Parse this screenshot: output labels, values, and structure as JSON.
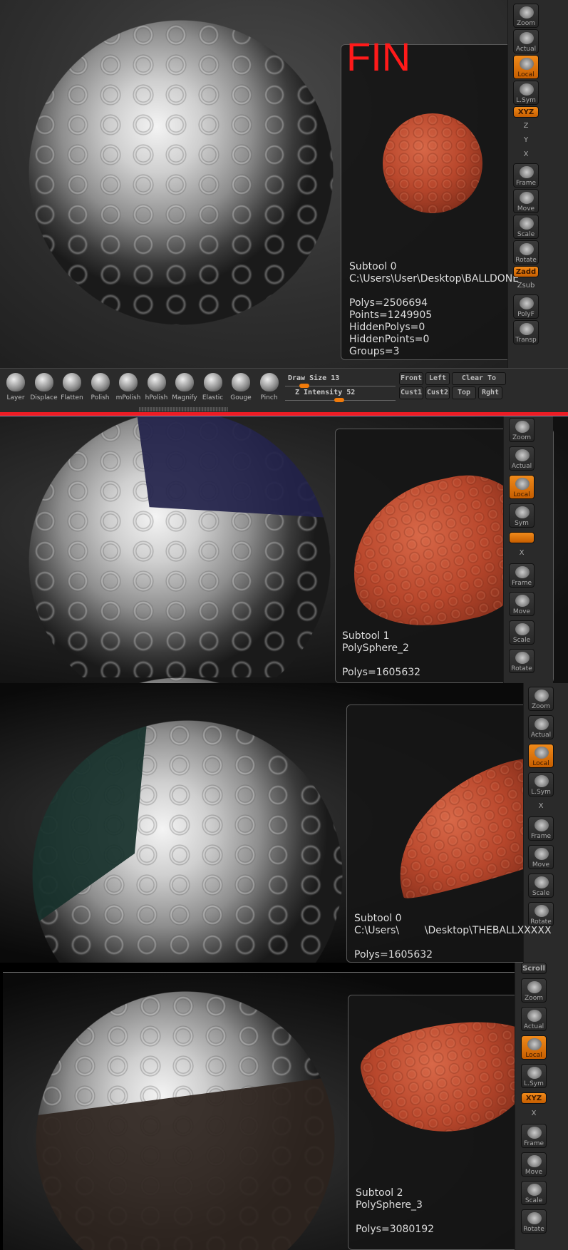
{
  "accent": "#f07a0a",
  "annotation_color": "#ff1a1a",
  "annotation": "FIN",
  "panels": [
    {
      "info": [
        "Subtool 0",
        "C:\\Users\\User\\Desktop\\BALLDONE",
        "",
        "Polys=2506694",
        "Points=1249905",
        "HiddenPolys=0",
        "HiddenPoints=0",
        "Groups=3"
      ],
      "toolbar": [
        {
          "label": "Zoom"
        },
        {
          "label": "Actual"
        },
        {
          "label": "Local",
          "active": true
        },
        {
          "label": "L.Sym"
        },
        {
          "label": "XYZ",
          "active": true,
          "small": true
        },
        {
          "label": "Z",
          "plain": true
        },
        {
          "label": "Y",
          "plain": true
        },
        {
          "label": "X",
          "plain": true
        },
        {
          "label": "Frame"
        },
        {
          "label": "Move"
        },
        {
          "label": "Scale"
        },
        {
          "label": "Rotate"
        },
        {
          "label": "Zadd",
          "active": true,
          "small": true
        },
        {
          "label": "Zsub",
          "plain": true
        },
        {
          "label": "PolyF"
        },
        {
          "label": "Transp"
        }
      ]
    },
    {
      "info": [
        "Subtool 1",
        "PolySphere_2",
        "",
        "Polys=1605632"
      ],
      "toolbar": [
        {
          "label": "Zoom"
        },
        {
          "label": "Actual"
        },
        {
          "label": "Local",
          "active": true
        },
        {
          "label": "Sym"
        },
        {
          "label": "",
          "active": true,
          "small": true
        },
        {
          "label": "X",
          "plain": true
        },
        {
          "label": "Frame"
        },
        {
          "label": "Move"
        },
        {
          "label": "Scale"
        },
        {
          "label": "Rotate"
        }
      ]
    },
    {
      "info": [
        "Subtool 0",
        "C:\\Users\\        \\Desktop\\THEBALLXXXXX",
        "",
        "Polys=1605632"
      ],
      "toolbar": [
        {
          "label": "Zoom"
        },
        {
          "label": "Actual"
        },
        {
          "label": "Local",
          "active": true
        },
        {
          "label": "L.Sym"
        },
        {
          "label": "X",
          "plain": true
        },
        {
          "label": "Frame"
        },
        {
          "label": "Move"
        },
        {
          "label": "Scale"
        },
        {
          "label": "Rotate"
        }
      ]
    },
    {
      "info": [
        "Subtool 2",
        "PolySphere_3",
        "",
        "Polys=3080192"
      ],
      "toolbar": [
        {
          "label": "Scroll",
          "small": true
        },
        {
          "label": "Zoom"
        },
        {
          "label": "Actual"
        },
        {
          "label": "Local",
          "active": true
        },
        {
          "label": "L.Sym"
        },
        {
          "label": "XYZ",
          "active": true,
          "small": true
        },
        {
          "label": "X",
          "plain": true
        },
        {
          "label": "Frame"
        },
        {
          "label": "Move"
        },
        {
          "label": "Scale"
        },
        {
          "label": "Rotate"
        }
      ]
    }
  ],
  "shelf": {
    "brushes": [
      "Layer",
      "Displace",
      "Flatten",
      "Polish",
      "mPolish",
      "hPolish",
      "Magnify",
      "Elastic",
      "Gouge",
      "Pinch"
    ],
    "draw_size_label": "Draw Size 13",
    "draw_size": 13,
    "z_intensity_label": "Z Intensity 52",
    "z_intensity": 52,
    "views": [
      "Front",
      "Left",
      "Clear To",
      "Cust1",
      "Cust2",
      "Top",
      "Rght"
    ]
  }
}
